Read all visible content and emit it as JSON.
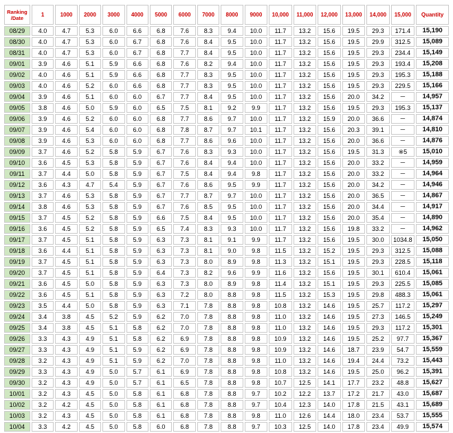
{
  "table": {
    "corner_line1": "Ranking",
    "corner_line2": "/Date",
    "rank_headers": [
      "1",
      "1000",
      "2000",
      "3000",
      "4000",
      "5000",
      "6000",
      "7000",
      "8000",
      "9000",
      "10,000",
      "11,000",
      "12,000",
      "13,000",
      "14,000",
      "15,000"
    ],
    "quantity_header": "Quantity",
    "rows": [
      {
        "date": "08/29",
        "values": [
          "4.0",
          "4.7",
          "5.3",
          "6.0",
          "6.6",
          "6.8",
          "7.6",
          "8.3",
          "9.4",
          "10.0",
          "11.7",
          "13.2",
          "15.6",
          "19.5",
          "29.3",
          "171.4"
        ],
        "quantity": "15,190"
      },
      {
        "date": "08/30",
        "values": [
          "4.0",
          "4.7",
          "5.3",
          "6.0",
          "6.7",
          "6.8",
          "7.6",
          "8.4",
          "9.5",
          "10.0",
          "11.7",
          "13.2",
          "15.6",
          "19.5",
          "29.9",
          "312.5"
        ],
        "quantity": "15,089"
      },
      {
        "date": "08/31",
        "values": [
          "4.0",
          "4.7",
          "5.3",
          "6.0",
          "6.7",
          "6.8",
          "7.7",
          "8.4",
          "9.5",
          "10.0",
          "11.7",
          "13.2",
          "15.6",
          "19.5",
          "29.3",
          "234.4"
        ],
        "quantity": "15,149"
      },
      {
        "date": "09/01",
        "values": [
          "3.9",
          "4.6",
          "5.1",
          "5.9",
          "6.6",
          "6.8",
          "7.6",
          "8.2",
          "9.4",
          "10.0",
          "11.7",
          "13.2",
          "15.6",
          "19.5",
          "29.3",
          "193.4"
        ],
        "quantity": "15,208"
      },
      {
        "date": "09/02",
        "values": [
          "4.0",
          "4.6",
          "5.1",
          "5.9",
          "6.6",
          "6.8",
          "7.7",
          "8.3",
          "9.5",
          "10.0",
          "11.7",
          "13.2",
          "15.6",
          "19.5",
          "29.3",
          "195.3"
        ],
        "quantity": "15,188"
      },
      {
        "date": "09/03",
        "values": [
          "4.0",
          "4.6",
          "5.2",
          "6.0",
          "6.6",
          "6.8",
          "7.7",
          "8.3",
          "9.5",
          "10.0",
          "11.7",
          "13.2",
          "15.6",
          "19.5",
          "29.3",
          "229.5"
        ],
        "quantity": "15,166"
      },
      {
        "date": "09/04",
        "values": [
          "3.9",
          "4.6",
          "5.1",
          "6.0",
          "6.0",
          "6.7",
          "7.7",
          "8.4",
          "9.5",
          "10.0",
          "11.7",
          "13.2",
          "15.6",
          "20.0",
          "34.2",
          "－"
        ],
        "quantity": "14,957"
      },
      {
        "date": "09/05",
        "values": [
          "3.8",
          "4.6",
          "5.0",
          "5.9",
          "6.0",
          "6.5",
          "7.5",
          "8.1",
          "9.2",
          "9.9",
          "11.7",
          "13.2",
          "15.6",
          "19.5",
          "29.3",
          "195.3"
        ],
        "quantity": "15,137"
      },
      {
        "date": "09/06",
        "values": [
          "3.9",
          "4.6",
          "5.2",
          "6.0",
          "6.0",
          "6.8",
          "7.7",
          "8.6",
          "9.7",
          "10.0",
          "11.7",
          "13.2",
          "15.9",
          "20.0",
          "36.6",
          "－"
        ],
        "quantity": "14,874"
      },
      {
        "date": "09/07",
        "values": [
          "3.9",
          "4.6",
          "5.4",
          "6.0",
          "6.0",
          "6.8",
          "7.8",
          "8.7",
          "9.7",
          "10.1",
          "11.7",
          "13.2",
          "15.6",
          "20.3",
          "39.1",
          "－"
        ],
        "quantity": "14,810"
      },
      {
        "date": "09/08",
        "values": [
          "3.9",
          "4.6",
          "5.3",
          "6.0",
          "6.0",
          "6.8",
          "7.7",
          "8.6",
          "9.6",
          "10.0",
          "11.7",
          "13.2",
          "15.6",
          "20.0",
          "36.6",
          "－"
        ],
        "quantity": "14,876"
      },
      {
        "date": "09/09",
        "values": [
          "3.7",
          "4.6",
          "5.2",
          "5.8",
          "5.9",
          "6.7",
          "7.6",
          "8.3",
          "9.3",
          "10.0",
          "11.7",
          "13.2",
          "15.6",
          "19.5",
          "31.3",
          "※5"
        ],
        "quantity": "15,010"
      },
      {
        "date": "09/10",
        "values": [
          "3.6",
          "4.5",
          "5.3",
          "5.8",
          "5.9",
          "6.7",
          "7.6",
          "8.4",
          "9.4",
          "10.0",
          "11.7",
          "13.2",
          "15.6",
          "20.0",
          "33.2",
          "－"
        ],
        "quantity": "14,959"
      },
      {
        "date": "09/11",
        "values": [
          "3.7",
          "4.4",
          "5.0",
          "5.8",
          "5.9",
          "6.7",
          "7.5",
          "8.4",
          "9.4",
          "9.8",
          "11.7",
          "13.2",
          "15.6",
          "20.0",
          "33.2",
          "－"
        ],
        "quantity": "14,964"
      },
      {
        "date": "09/12",
        "values": [
          "3.6",
          "4.3",
          "4.7",
          "5.4",
          "5.9",
          "6.7",
          "7.6",
          "8.6",
          "9.5",
          "9.9",
          "11.7",
          "13.2",
          "15.6",
          "20.0",
          "34.2",
          "－"
        ],
        "quantity": "14,946"
      },
      {
        "date": "09/13",
        "values": [
          "3.7",
          "4.6",
          "5.3",
          "5.8",
          "5.9",
          "6.7",
          "7.7",
          "8.7",
          "9.7",
          "10.0",
          "11.7",
          "13.2",
          "15.6",
          "20.0",
          "36.5",
          "－"
        ],
        "quantity": "14,867"
      },
      {
        "date": "09/14",
        "values": [
          "3.8",
          "4.6",
          "5.3",
          "5.8",
          "5.9",
          "6.7",
          "7.6",
          "8.5",
          "9.5",
          "10.0",
          "11.7",
          "13.2",
          "15.6",
          "20.0",
          "34.4",
          "－"
        ],
        "quantity": "14,917"
      },
      {
        "date": "09/15",
        "values": [
          "3.7",
          "4.5",
          "5.2",
          "5.8",
          "5.9",
          "6.6",
          "7.5",
          "8.4",
          "9.5",
          "10.0",
          "11.7",
          "13.2",
          "15.6",
          "20.0",
          "35.4",
          "－"
        ],
        "quantity": "14,890"
      },
      {
        "date": "09/16",
        "values": [
          "3.6",
          "4.5",
          "5.2",
          "5.8",
          "5.9",
          "6.5",
          "7.4",
          "8.3",
          "9.3",
          "10.0",
          "11.7",
          "13.2",
          "15.6",
          "19.8",
          "33.2",
          "－"
        ],
        "quantity": "14,962"
      },
      {
        "date": "09/17",
        "values": [
          "3.7",
          "4.5",
          "5.1",
          "5.8",
          "5.9",
          "6.3",
          "7.3",
          "8.1",
          "9.1",
          "9.9",
          "11.7",
          "13.2",
          "15.6",
          "19.5",
          "30.0",
          "1034.8"
        ],
        "quantity": "15,050"
      },
      {
        "date": "09/18",
        "values": [
          "3.6",
          "4.4",
          "5.1",
          "5.8",
          "5.9",
          "6.3",
          "7.3",
          "8.1",
          "9.0",
          "9.8",
          "11.5",
          "13.2",
          "15.2",
          "19.5",
          "29.3",
          "312.5"
        ],
        "quantity": "15,088"
      },
      {
        "date": "09/19",
        "values": [
          "3.7",
          "4.5",
          "5.1",
          "5.8",
          "5.9",
          "6.3",
          "7.3",
          "8.0",
          "8.9",
          "9.8",
          "11.3",
          "13.2",
          "15.1",
          "19.5",
          "29.3",
          "228.5"
        ],
        "quantity": "15,118"
      },
      {
        "date": "09/20",
        "values": [
          "3.7",
          "4.5",
          "5.1",
          "5.8",
          "5.9",
          "6.4",
          "7.3",
          "8.2",
          "9.6",
          "9.9",
          "11.6",
          "13.2",
          "15.6",
          "19.5",
          "30.1",
          "610.4"
        ],
        "quantity": "15,061"
      },
      {
        "date": "09/21",
        "values": [
          "3.6",
          "4.5",
          "5.0",
          "5.8",
          "5.9",
          "6.3",
          "7.3",
          "8.0",
          "8.9",
          "9.8",
          "11.4",
          "13.2",
          "15.1",
          "19.5",
          "29.3",
          "225.5"
        ],
        "quantity": "15,085"
      },
      {
        "date": "09/22",
        "values": [
          "3.6",
          "4.5",
          "5.1",
          "5.8",
          "5.9",
          "6.3",
          "7.2",
          "8.0",
          "8.8",
          "9.8",
          "11.5",
          "13.2",
          "15.3",
          "19.5",
          "29.8",
          "488.3"
        ],
        "quantity": "15,061"
      },
      {
        "date": "09/23",
        "values": [
          "3.5",
          "4.4",
          "5.0",
          "5.8",
          "5.9",
          "6.3",
          "7.1",
          "7.8",
          "8.8",
          "9.8",
          "10.8",
          "13.2",
          "14.6",
          "19.5",
          "25.7",
          "117.2"
        ],
        "quantity": "15,297"
      },
      {
        "date": "09/24",
        "values": [
          "3.4",
          "3.8",
          "4.5",
          "5.2",
          "5.9",
          "6.2",
          "7.0",
          "7.8",
          "8.8",
          "9.8",
          "11.0",
          "13.2",
          "14.6",
          "19.5",
          "27.3",
          "146.5"
        ],
        "quantity": "15,249"
      },
      {
        "date": "09/25",
        "values": [
          "3.4",
          "3.8",
          "4.5",
          "5.1",
          "5.8",
          "6.2",
          "7.0",
          "7.8",
          "8.8",
          "9.8",
          "11.0",
          "13.2",
          "14.6",
          "19.5",
          "29.3",
          "117.2"
        ],
        "quantity": "15,301"
      },
      {
        "date": "09/26",
        "values": [
          "3.3",
          "4.3",
          "4.9",
          "5.1",
          "5.8",
          "6.2",
          "6.9",
          "7.8",
          "8.8",
          "9.8",
          "10.9",
          "13.2",
          "14.6",
          "19.5",
          "25.2",
          "97.7"
        ],
        "quantity": "15,367"
      },
      {
        "date": "09/27",
        "values": [
          "3.3",
          "4.3",
          "4.9",
          "5.1",
          "5.9",
          "6.2",
          "6.9",
          "7.8",
          "8.8",
          "9.8",
          "10.9",
          "13.2",
          "14.6",
          "18.7",
          "23.9",
          "54.7"
        ],
        "quantity": "15,559"
      },
      {
        "date": "09/28",
        "values": [
          "3.2",
          "4.3",
          "4.9",
          "5.1",
          "5.9",
          "6.2",
          "7.0",
          "7.8",
          "8.8",
          "9.8",
          "11.0",
          "13.2",
          "14.6",
          "19.4",
          "24.4",
          "73.2"
        ],
        "quantity": "15,443"
      },
      {
        "date": "09/29",
        "values": [
          "3.3",
          "4.3",
          "4.9",
          "5.0",
          "5.7",
          "6.1",
          "6.9",
          "7.8",
          "8.8",
          "9.8",
          "10.8",
          "13.2",
          "14.6",
          "19.5",
          "25.0",
          "96.2"
        ],
        "quantity": "15,391"
      },
      {
        "date": "09/30",
        "values": [
          "3.2",
          "4.3",
          "4.9",
          "5.0",
          "5.7",
          "6.1",
          "6.5",
          "7.8",
          "8.8",
          "9.8",
          "10.7",
          "12.5",
          "14.1",
          "17.7",
          "23.2",
          "48.8"
        ],
        "quantity": "15,627"
      },
      {
        "date": "10/01",
        "values": [
          "3.2",
          "4.3",
          "4.5",
          "5.0",
          "5.8",
          "6.1",
          "6.8",
          "7.8",
          "8.8",
          "9.7",
          "10.2",
          "12.2",
          "13.7",
          "17.2",
          "21.7",
          "43.0"
        ],
        "quantity": "15,687"
      },
      {
        "date": "10/02",
        "values": [
          "3.2",
          "4.2",
          "4.5",
          "5.0",
          "5.8",
          "6.1",
          "6.8",
          "7.8",
          "8.8",
          "9.7",
          "10.4",
          "12.3",
          "14.0",
          "17.8",
          "21.5",
          "43.1"
        ],
        "quantity": "15,689"
      },
      {
        "date": "10/03",
        "values": [
          "3.2",
          "4.3",
          "4.5",
          "5.0",
          "5.8",
          "6.1",
          "6.8",
          "7.8",
          "8.8",
          "9.8",
          "11.0",
          "12.6",
          "14.4",
          "18.0",
          "23.4",
          "53.7"
        ],
        "quantity": "15,555"
      },
      {
        "date": "10/04",
        "values": [
          "3.3",
          "4.2",
          "4.5",
          "5.0",
          "5.8",
          "6.0",
          "6.8",
          "7.8",
          "8.8",
          "9.7",
          "10.3",
          "12.5",
          "14.0",
          "17.8",
          "23.4",
          "49.9"
        ],
        "quantity": "15,574"
      }
    ]
  },
  "colors": {
    "header_text": "#cc0000",
    "date_cell_bg": "#cfe7c1",
    "cell_border": "#c9c9c9"
  }
}
